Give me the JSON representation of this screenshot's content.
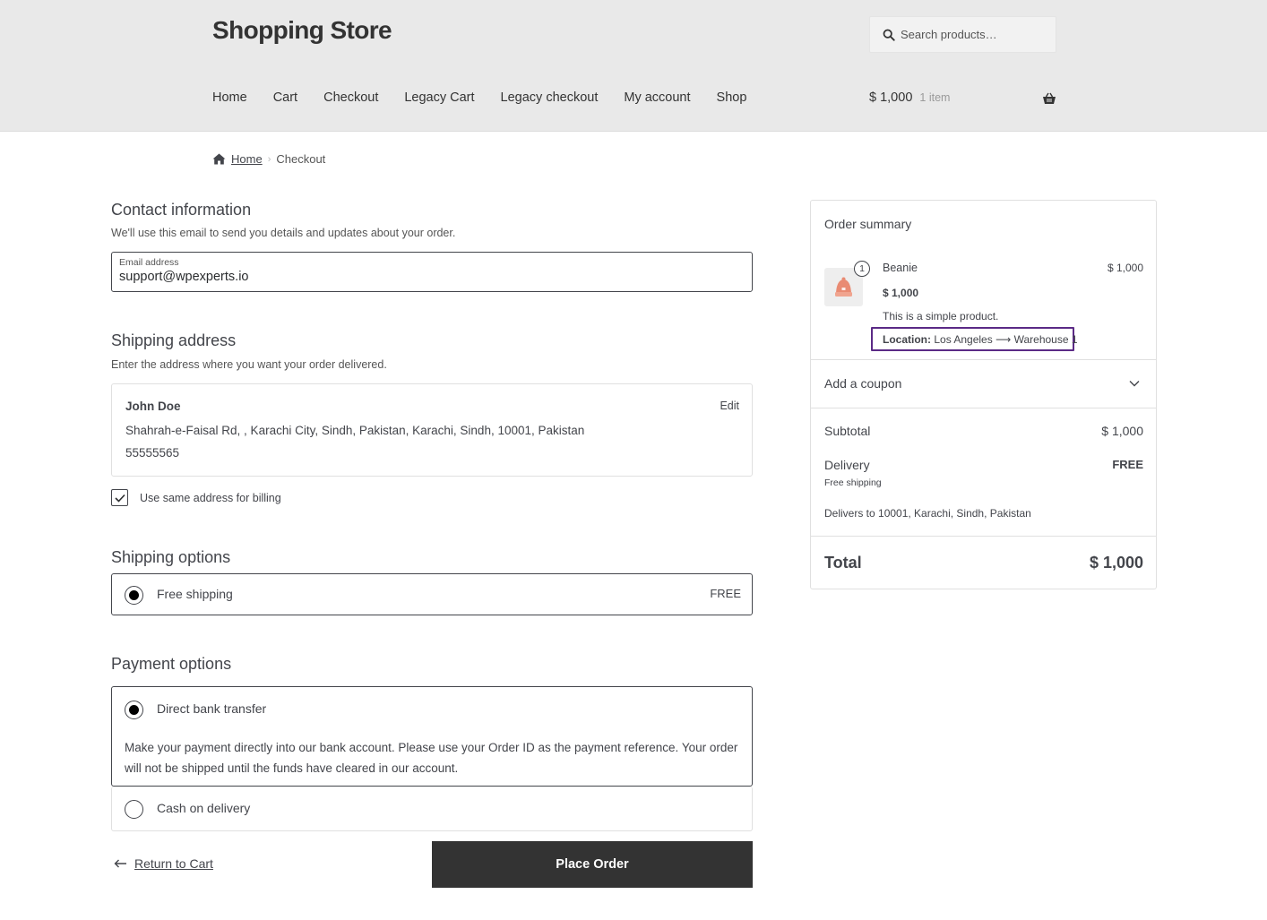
{
  "header": {
    "site_title": "Shopping Store",
    "search_placeholder": "Search products…",
    "nav": [
      "Home",
      "Cart",
      "Checkout",
      "Legacy Cart",
      "Legacy checkout",
      "My account",
      "Shop"
    ],
    "cart_total": "$ 1,000",
    "cart_count": "1 item"
  },
  "breadcrumb": {
    "home": "Home",
    "current": "Checkout"
  },
  "contact": {
    "title": "Contact information",
    "description": "We'll use this email to send you details and updates about your order.",
    "email_label": "Email address",
    "email_value": "support@wpexperts.io"
  },
  "shipping_address": {
    "title": "Shipping address",
    "description": "Enter the address where you want your order delivered.",
    "name": "John Doe",
    "address": "Shahrah-e-Faisal Rd, , Karachi City, Sindh, Pakistan, Karachi, Sindh, 10001, Pakistan",
    "phone": "55555565",
    "edit_label": "Edit",
    "billing_same_label": "Use same address for billing",
    "billing_same_checked": true
  },
  "shipping_options": {
    "title": "Shipping options",
    "option_label": "Free shipping",
    "option_price": "FREE"
  },
  "payment_options": {
    "title": "Payment options",
    "bank_label": "Direct bank transfer",
    "bank_description_1": "Make your payment directly into our bank account. Please use your Order ID as the payment reference. Your order",
    "bank_description_2": "will not be shipped until the funds have cleared in our account.",
    "cod_label": "Cash on delivery"
  },
  "actions": {
    "return_label": "Return to Cart",
    "place_order_label": "Place Order"
  },
  "summary": {
    "title": "Order summary",
    "item": {
      "qty": "1",
      "name": "Beanie",
      "line_total": "$ 1,000",
      "unit_price": "$ 1,000",
      "description": "This is a simple product.",
      "location_label": "Location:",
      "location_value": "Los Angeles ⟶ Warehouse 1"
    },
    "coupon_label": "Add a coupon",
    "subtotal_label": "Subtotal",
    "subtotal_value": "$ 1,000",
    "delivery_label": "Delivery",
    "delivery_value": "FREE",
    "delivery_method": "Free shipping",
    "delivers_to": "Delivers to 10001, Karachi, Sindh, Pakistan",
    "total_label": "Total",
    "total_value": "$ 1,000"
  },
  "colors": {
    "header_bg": "#e9e9e9",
    "text": "#43454b",
    "button_bg": "#333333",
    "highlight_border": "#5b2a86"
  }
}
